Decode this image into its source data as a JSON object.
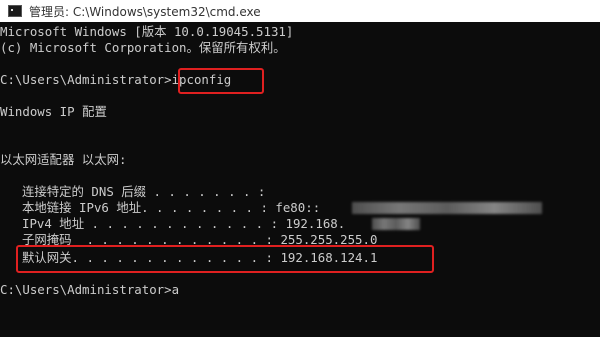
{
  "window": {
    "title": "管理员: C:\\Windows\\system32\\cmd.exe"
  },
  "console": {
    "header_line1": "Microsoft Windows [版本 10.0.19045.5131]",
    "header_line2": "(c) Microsoft Corporation。保留所有权利。",
    "prompt1": "C:\\Users\\Administrator>",
    "command1": "ipconfig",
    "ip_config_title": "Windows IP 配置",
    "adapter_heading": "以太网适配器 以太网:",
    "entries": [
      {
        "label": "连接特定的 DNS 后缀 . . . . . . . :",
        "value": ""
      },
      {
        "label": "本地链接 IPv6 地址. . . . . . . . :",
        "value": "fe80::"
      },
      {
        "label": "IPv4 地址 . . . . . . . . . . . . :",
        "value": "192.168."
      },
      {
        "label": "子网掩码  . . . . . . . . . . . . :",
        "value": "255.255.255.0"
      },
      {
        "label": "默认网关. . . . . . . . . . . . . :",
        "value": "192.168.124.1"
      }
    ],
    "prompt2": "C:\\Users\\Administrator>",
    "command2": "a"
  },
  "colors": {
    "background": "#0c0c0c",
    "text": "#cccccc",
    "highlight": "#e02020",
    "titlebar": "#ffffff"
  }
}
